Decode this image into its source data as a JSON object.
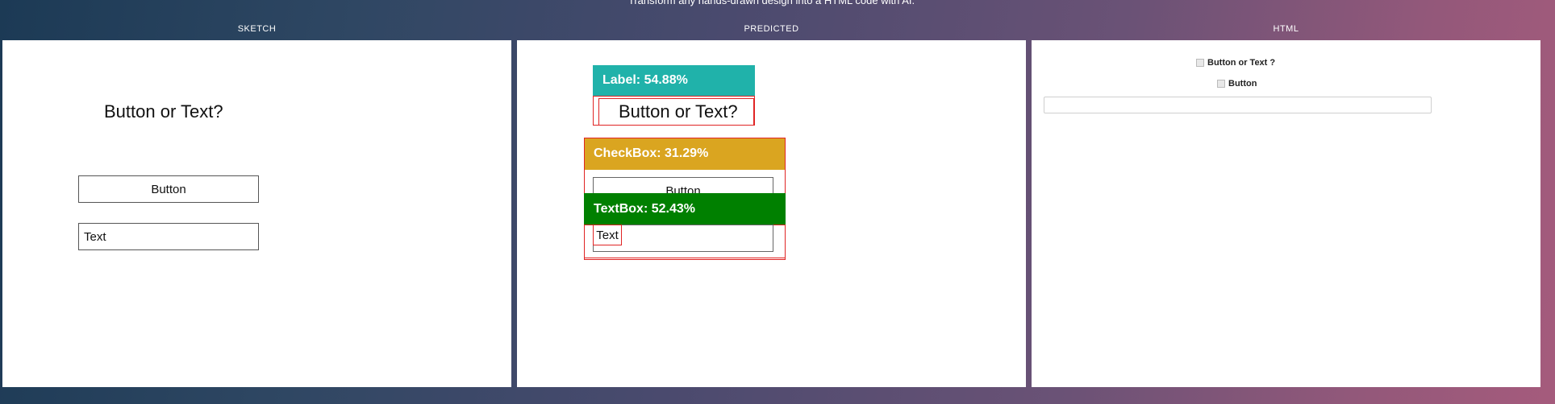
{
  "header": {
    "tagline": "Transform any hands-drawn design into a HTML code with AI."
  },
  "panels": {
    "sketch": {
      "title": "SKETCH",
      "heading": "Button or Text?",
      "button_label": "Button",
      "text_label": "Text"
    },
    "predicted": {
      "title": "PREDICTED",
      "label_tag": "Label: 54.88%",
      "label_color": "#20b2aa",
      "heading": "Button or Text?",
      "checkbox_tag": "CheckBox: 31.29%",
      "checkbox_color": "#daa520",
      "button_label": "Button",
      "textbox_tag": "TextBox: 52.43%",
      "textbox_color": "#008000",
      "text_label": "Text"
    },
    "html": {
      "title": "HTML",
      "checkbox1_label": "Button or Text ?",
      "checkbox2_label": "Button"
    }
  }
}
